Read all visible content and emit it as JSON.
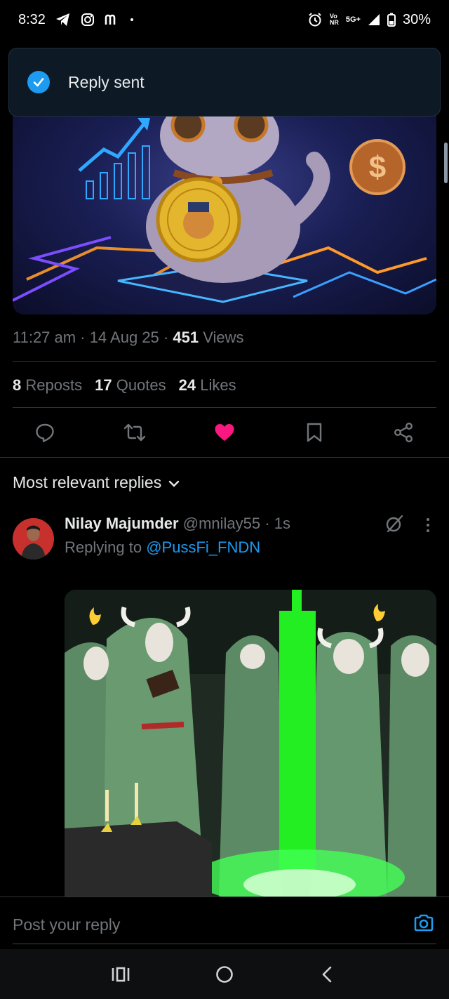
{
  "status_bar": {
    "time": "8:32",
    "network_top": "Vo",
    "network_bottom": "NR",
    "signal_label": "5G+",
    "battery": "30%",
    "icons": [
      "telegram-icon",
      "instagram-icon",
      "m-icon",
      "dot-icon",
      "alarm-icon",
      "signal-icon",
      "battery-icon"
    ]
  },
  "toast": {
    "text": "Reply sent",
    "icon": "check-circle-icon",
    "accent": "#1d9bf0"
  },
  "post": {
    "time": "11:27 am",
    "date": "14 Aug 25",
    "views_count": "451",
    "views_label": "Views",
    "separator": "·"
  },
  "stats": {
    "reposts_count": "8",
    "reposts_label": "Reposts",
    "quotes_count": "17",
    "quotes_label": "Quotes",
    "likes_count": "24",
    "likes_label": "Likes"
  },
  "actions": [
    "reply-icon",
    "repost-icon",
    "like-icon",
    "bookmark-icon",
    "share-icon"
  ],
  "like_color": "#f91880",
  "sort": {
    "label": "Most relevant replies"
  },
  "reply": {
    "name": "Nilay Majumder",
    "handle": "@mnilay55",
    "time": "1s",
    "separator": "·",
    "replying_prefix": "Replying to",
    "replying_handle": "@PussFi_FNDN"
  },
  "composer": {
    "placeholder": "Post your reply"
  },
  "colors": {
    "accent": "#1d9bf0",
    "muted": "#71767b",
    "text": "#e7e9ea",
    "background": "#000000"
  }
}
